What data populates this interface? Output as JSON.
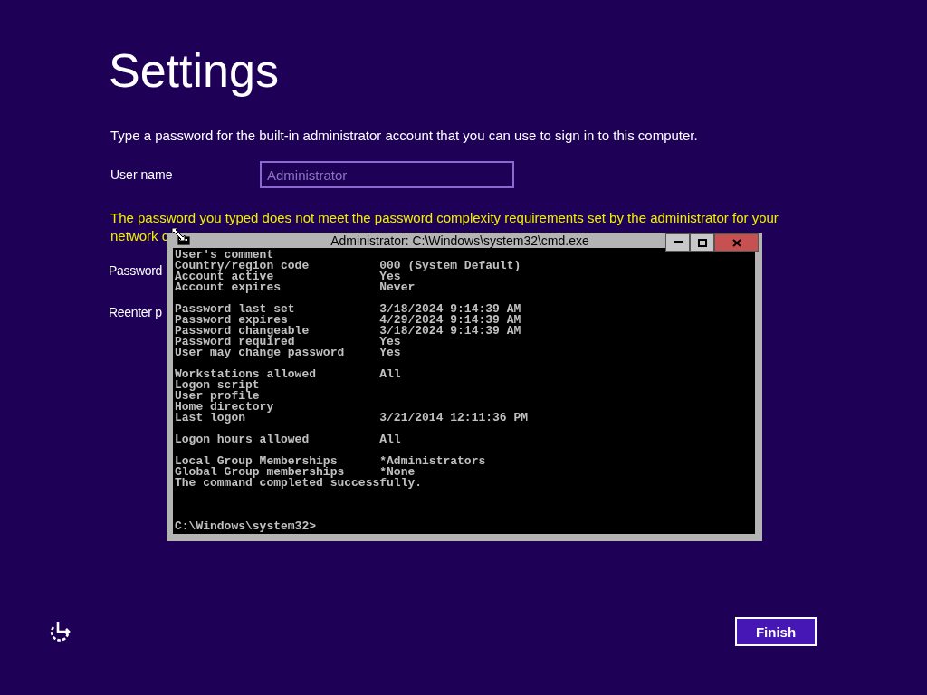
{
  "page": {
    "title": "Settings",
    "instruction": "Type a password for the built-in administrator account that you can use to sign in to this computer.",
    "user_name": {
      "label": "User name",
      "placeholder": "Administrator"
    },
    "warning_lines": [
      "The password you typed does not meet the password complexity requirements set by the administrator for your",
      "network c"
    ],
    "password_label": "Password",
    "reenter_label": "Reenter p",
    "finish_button": "Finish"
  },
  "console_window": {
    "title": "Administrator: C:\\Windows\\system32\\cmd.exe",
    "blocks": [
      [
        {
          "label": "User's comment"
        },
        {
          "label": "Country/region code",
          "value": "000 (System Default)"
        },
        {
          "label": "Account active",
          "value": "Yes"
        },
        {
          "label": "Account expires",
          "value": "Never"
        }
      ],
      [
        {
          "label": "Password last set",
          "value": "3/18/2024 9:14:39 AM"
        },
        {
          "label": "Password expires",
          "value": "4/29/2024 9:14:39 AM"
        },
        {
          "label": "Password changeable",
          "value": "3/18/2024 9:14:39 AM"
        },
        {
          "label": "Password required",
          "value": "Yes"
        },
        {
          "label": "User may change password",
          "value": "Yes"
        }
      ],
      [
        {
          "label": "Workstations allowed",
          "value": "All"
        },
        {
          "label": "Logon script"
        },
        {
          "label": "User profile"
        },
        {
          "label": "Home directory"
        },
        {
          "label": "Last logon",
          "value": "3/21/2014 12:11:36 PM"
        }
      ],
      [
        {
          "label": "Logon hours allowed",
          "value": "All"
        }
      ],
      [
        {
          "label": "Local Group Memberships",
          "value": "*Administrators"
        },
        {
          "label": "Global Group memberships",
          "value": "*None"
        },
        {
          "label": "The command completed successfully."
        }
      ]
    ],
    "prompt": "C:\\Windows\\system32>"
  }
}
